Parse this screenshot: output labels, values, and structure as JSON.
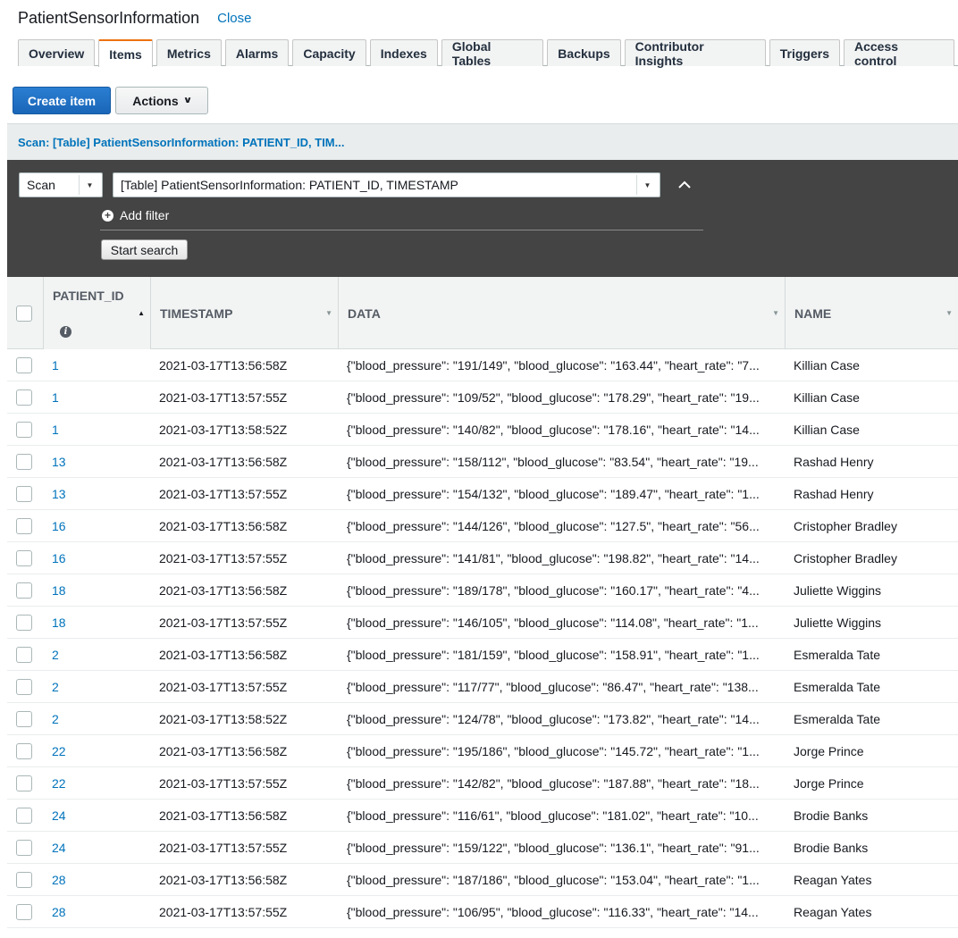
{
  "header": {
    "table_title": "PatientSensorInformation",
    "close_label": "Close"
  },
  "tabs": [
    {
      "label": "Overview"
    },
    {
      "label": "Items"
    },
    {
      "label": "Metrics"
    },
    {
      "label": "Alarms"
    },
    {
      "label": "Capacity"
    },
    {
      "label": "Indexes"
    },
    {
      "label": "Global Tables"
    },
    {
      "label": "Backups"
    },
    {
      "label": "Contributor Insights"
    },
    {
      "label": "Triggers"
    },
    {
      "label": "Access control"
    }
  ],
  "active_tab": "Items",
  "toolbar": {
    "create_label": "Create item",
    "actions_label": "Actions"
  },
  "scan": {
    "header": "Scan: [Table] PatientSensorInformation: PATIENT_ID, TIM...",
    "mode_value": "Scan",
    "target_value": "[Table] PatientSensorInformation: PATIENT_ID, TIMESTAMP",
    "add_filter_label": "Add filter",
    "start_search_label": "Start search"
  },
  "table": {
    "columns": [
      "PATIENT_ID",
      "TIMESTAMP",
      "DATA",
      "NAME"
    ],
    "rows": [
      {
        "id": "1",
        "timestamp": "2021-03-17T13:56:58Z",
        "data": "{\"blood_pressure\": \"191/149\", \"blood_glucose\": \"163.44\", \"heart_rate\": \"7...",
        "name": "Killian Case"
      },
      {
        "id": "1",
        "timestamp": "2021-03-17T13:57:55Z",
        "data": "{\"blood_pressure\": \"109/52\", \"blood_glucose\": \"178.29\", \"heart_rate\": \"19...",
        "name": "Killian Case"
      },
      {
        "id": "1",
        "timestamp": "2021-03-17T13:58:52Z",
        "data": "{\"blood_pressure\": \"140/82\", \"blood_glucose\": \"178.16\", \"heart_rate\": \"14...",
        "name": "Killian Case"
      },
      {
        "id": "13",
        "timestamp": "2021-03-17T13:56:58Z",
        "data": "{\"blood_pressure\": \"158/112\", \"blood_glucose\": \"83.54\", \"heart_rate\": \"19...",
        "name": "Rashad Henry"
      },
      {
        "id": "13",
        "timestamp": "2021-03-17T13:57:55Z",
        "data": "{\"blood_pressure\": \"154/132\", \"blood_glucose\": \"189.47\", \"heart_rate\": \"1...",
        "name": "Rashad Henry"
      },
      {
        "id": "16",
        "timestamp": "2021-03-17T13:56:58Z",
        "data": "{\"blood_pressure\": \"144/126\", \"blood_glucose\": \"127.5\", \"heart_rate\": \"56...",
        "name": "Cristopher Bradley"
      },
      {
        "id": "16",
        "timestamp": "2021-03-17T13:57:55Z",
        "data": "{\"blood_pressure\": \"141/81\", \"blood_glucose\": \"198.82\", \"heart_rate\": \"14...",
        "name": "Cristopher Bradley"
      },
      {
        "id": "18",
        "timestamp": "2021-03-17T13:56:58Z",
        "data": "{\"blood_pressure\": \"189/178\", \"blood_glucose\": \"160.17\", \"heart_rate\": \"4...",
        "name": "Juliette Wiggins"
      },
      {
        "id": "18",
        "timestamp": "2021-03-17T13:57:55Z",
        "data": "{\"blood_pressure\": \"146/105\", \"blood_glucose\": \"114.08\", \"heart_rate\": \"1...",
        "name": "Juliette Wiggins"
      },
      {
        "id": "2",
        "timestamp": "2021-03-17T13:56:58Z",
        "data": "{\"blood_pressure\": \"181/159\", \"blood_glucose\": \"158.91\", \"heart_rate\": \"1...",
        "name": "Esmeralda Tate"
      },
      {
        "id": "2",
        "timestamp": "2021-03-17T13:57:55Z",
        "data": "{\"blood_pressure\": \"117/77\", \"blood_glucose\": \"86.47\", \"heart_rate\": \"138...",
        "name": "Esmeralda Tate"
      },
      {
        "id": "2",
        "timestamp": "2021-03-17T13:58:52Z",
        "data": "{\"blood_pressure\": \"124/78\", \"blood_glucose\": \"173.82\", \"heart_rate\": \"14...",
        "name": "Esmeralda Tate"
      },
      {
        "id": "22",
        "timestamp": "2021-03-17T13:56:58Z",
        "data": "{\"blood_pressure\": \"195/186\", \"blood_glucose\": \"145.72\", \"heart_rate\": \"1...",
        "name": "Jorge Prince"
      },
      {
        "id": "22",
        "timestamp": "2021-03-17T13:57:55Z",
        "data": "{\"blood_pressure\": \"142/82\", \"blood_glucose\": \"187.88\", \"heart_rate\": \"18...",
        "name": "Jorge Prince"
      },
      {
        "id": "24",
        "timestamp": "2021-03-17T13:56:58Z",
        "data": "{\"blood_pressure\": \"116/61\", \"blood_glucose\": \"181.02\", \"heart_rate\": \"10...",
        "name": "Brodie Banks"
      },
      {
        "id": "24",
        "timestamp": "2021-03-17T13:57:55Z",
        "data": "{\"blood_pressure\": \"159/122\", \"blood_glucose\": \"136.1\", \"heart_rate\": \"91...",
        "name": "Brodie Banks"
      },
      {
        "id": "28",
        "timestamp": "2021-03-17T13:56:58Z",
        "data": "{\"blood_pressure\": \"187/186\", \"blood_glucose\": \"153.04\", \"heart_rate\": \"1...",
        "name": "Reagan Yates"
      },
      {
        "id": "28",
        "timestamp": "2021-03-17T13:57:55Z",
        "data": "{\"blood_pressure\": \"106/95\", \"blood_glucose\": \"116.33\", \"heart_rate\": \"14...",
        "name": "Reagan Yates"
      }
    ]
  },
  "colors": {
    "link": "#0073bb",
    "primary_button": "#1f6fc5",
    "active_tab_accent": "#ec7211",
    "scan_panel": "#444444"
  },
  "icons": {
    "sort_asc": "caret-up-icon",
    "sort_none": "caret-down-icon",
    "info": "info-icon",
    "add": "plus-circle-icon",
    "collapse": "chevron-up-icon",
    "dropdown": "caret-down-icon"
  }
}
